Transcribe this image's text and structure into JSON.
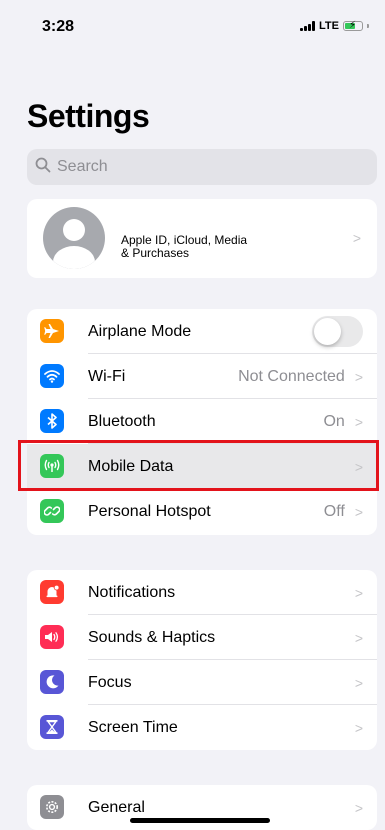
{
  "status_bar": {
    "time": "3:28",
    "network": "LTE"
  },
  "header": {
    "title": "Settings"
  },
  "search": {
    "placeholder": "Search"
  },
  "profile": {
    "line1": "Apple ID, iCloud, Media",
    "line2": "& Purchases"
  },
  "group1": {
    "items": [
      {
        "label": "Airplane Mode",
        "icon": "airplane-icon",
        "color": "#ff9500",
        "toggle": false
      },
      {
        "label": "Wi-Fi",
        "value": "Not Connected",
        "icon": "wifi-icon",
        "color": "#007aff"
      },
      {
        "label": "Bluetooth",
        "value": "On",
        "icon": "bluetooth-icon",
        "color": "#007aff"
      },
      {
        "label": "Mobile Data",
        "value": "",
        "icon": "antenna-icon",
        "color": "#34c759",
        "highlighted": true
      },
      {
        "label": "Personal Hotspot",
        "value": "Off",
        "icon": "hotspot-icon",
        "color": "#34c759"
      }
    ]
  },
  "group2": {
    "items": [
      {
        "label": "Notifications",
        "icon": "bell-icon",
        "color": "#ff3b30"
      },
      {
        "label": "Sounds & Haptics",
        "icon": "speaker-icon",
        "color": "#ff2d55"
      },
      {
        "label": "Focus",
        "icon": "moon-icon",
        "color": "#5856d6"
      },
      {
        "label": "Screen Time",
        "icon": "hourglass-icon",
        "color": "#5856d6"
      }
    ]
  },
  "group3": {
    "items": [
      {
        "label": "General",
        "icon": "gear-icon",
        "color": "#8e8e93"
      }
    ]
  },
  "highlight_color": "#e3131b"
}
